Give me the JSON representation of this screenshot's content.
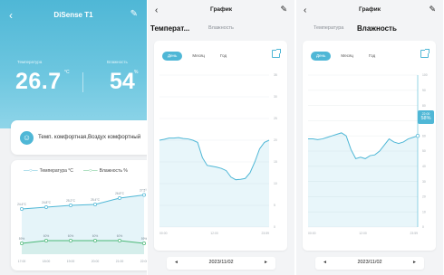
{
  "device": {
    "title": "DiSense T1",
    "temperature_label": "Температура",
    "temperature_value": "26.7",
    "temperature_unit": "°C",
    "humidity_label": "Влажность",
    "humidity_value": "54",
    "humidity_unit": "%",
    "comfort_text": "Темп. комфортная,Воздух комфортный",
    "legend_temp": "Температура °C",
    "legend_hum": "Влажность %"
  },
  "mini_chart": {
    "times": [
      "17:00",
      "18:00",
      "19:00",
      "20:00",
      "21:00",
      "22:00"
    ],
    "temperature": [
      24.4,
      24.8,
      25.2,
      25.4,
      26.8,
      27.5
    ],
    "temperature_labels": [
      "24.4°C",
      "24.8°C",
      "25.2°C",
      "25.4°C",
      "26.8°C",
      "27.5°C"
    ],
    "humidity": [
      59,
      60,
      60,
      60,
      60,
      59
    ],
    "humidity_labels": [
      "59%",
      "60%",
      "60%",
      "60%",
      "60%",
      "59%"
    ]
  },
  "graph": {
    "header_title": "График",
    "tab_temperature": "Температ...",
    "tab_humidity_small": "Влажность",
    "tab_temperature_small": "Температура",
    "tab_humidity": "Влажность",
    "range_day": "День",
    "range_month": "Месяц",
    "range_year": "Год",
    "date": "2023/11/02",
    "prev_arrow": "◄",
    "next_arrow": "►"
  },
  "temp_chart": {
    "type": "line",
    "y_ticks": [
      "35",
      "30",
      "25",
      "20",
      "15",
      "10",
      "5",
      "0"
    ],
    "x_ticks": [
      "00:00",
      "12:00",
      "23:59"
    ],
    "ylim": [
      0,
      35
    ],
    "x": [
      0,
      1,
      2,
      3,
      4,
      5,
      6,
      7,
      8,
      9,
      10,
      11,
      12,
      13,
      14,
      15,
      16,
      17,
      18,
      19,
      20,
      21,
      22,
      23
    ],
    "y": [
      20,
      20.2,
      20.5,
      20.5,
      20.6,
      20.4,
      20.3,
      20,
      19.5,
      16,
      14.2,
      14,
      13.8,
      13.5,
      13,
      11.5,
      10.9,
      11,
      11.2,
      12.5,
      15,
      18,
      19.5,
      20
    ]
  },
  "hum_chart": {
    "type": "line",
    "y_ticks": [
      "100",
      "90",
      "80",
      "70",
      "60",
      "50",
      "40",
      "30",
      "20",
      "10",
      "0"
    ],
    "x_ticks": [
      "00:00",
      "12:00",
      "23:59"
    ],
    "ylim": [
      0,
      100
    ],
    "tooltip_time": "22:00",
    "tooltip_value": "58%",
    "x": [
      0,
      1,
      2,
      3,
      4,
      5,
      6,
      7,
      8,
      9,
      10,
      11,
      12,
      13,
      14,
      15,
      16,
      17,
      18,
      19,
      20,
      21,
      22,
      23
    ],
    "y": [
      58,
      58,
      57.5,
      58,
      59,
      60,
      61,
      62,
      60,
      51,
      45,
      46,
      45,
      47,
      47.5,
      50,
      54,
      58,
      56,
      55,
      56,
      58,
      59,
      60
    ]
  },
  "colors": {
    "accent": "#4fb7d6",
    "humidity_line": "#4cb877"
  }
}
